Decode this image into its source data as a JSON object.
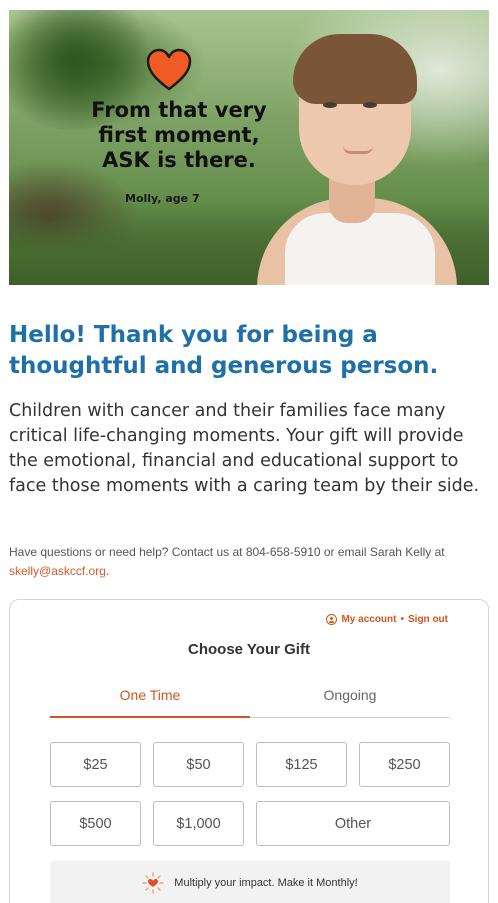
{
  "hero": {
    "quote_lines": [
      "From that very",
      "first moment,",
      "ASK is there."
    ],
    "attribution": "Molly, age 7",
    "heart_color": "#f05a24",
    "image_alt": "smiling-child-photo"
  },
  "headline": {
    "lines": [
      "Hello! Thank you for being a",
      "thoughtful and generous person."
    ],
    "color": "#1f6fa8"
  },
  "intro": "Children with cancer and their families face many critical life-changing moments. Your gift will provide the emotional, financial and educational support to face those moments with a caring team by their side.",
  "help": {
    "text": "Have questions or need help? Contact us at 804-658-5910 or email Sarah Kelly at ",
    "email": "skelly@askccf.org",
    "suffix": "."
  },
  "donation_form": {
    "account": {
      "my_account": "My account",
      "separator": "•",
      "sign_out": "Sign out",
      "icon": "user-circle-icon"
    },
    "title": "Choose Your Gift",
    "tabs": [
      {
        "label": "One Time",
        "active": true
      },
      {
        "label": "Ongoing",
        "active": false
      }
    ],
    "amounts": [
      "$25",
      "$50",
      "$125",
      "$250",
      "$500",
      "$1,000"
    ],
    "other_label": "Other",
    "monthly_banner": {
      "text": "Multiply your impact. Make it Monthly!",
      "icon": "heart-sparkle-icon"
    },
    "accent_color": "#d0561f"
  }
}
